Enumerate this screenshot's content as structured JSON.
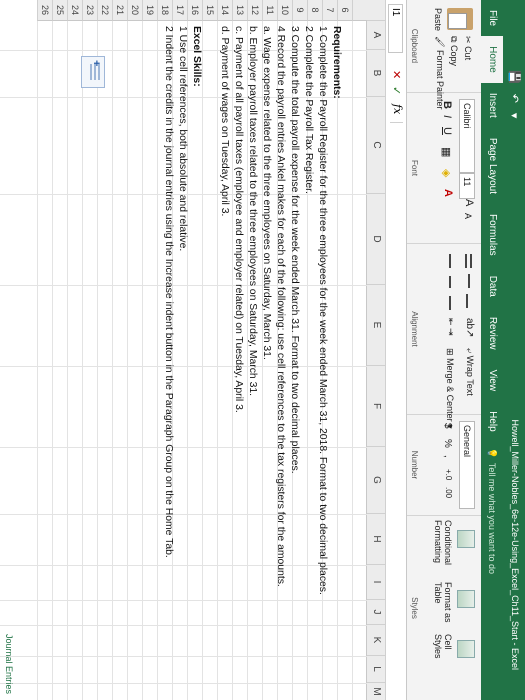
{
  "title_bar": {
    "document_title": "Howell_Miller-Nobles_6e-12e-Using_Excel_Ch11_Start - Excel"
  },
  "tabs": [
    "File",
    "Home",
    "Insert",
    "Page Layout",
    "Formulas",
    "Data",
    "Review",
    "View",
    "Help"
  ],
  "tell_me": "Tell me what you want to do",
  "ribbon": {
    "clipboard": {
      "cut": "Cut",
      "copy": "Copy",
      "format_painter": "Format Painter",
      "paste": "Paste",
      "label": "Clipboard"
    },
    "font": {
      "name": "Calibri",
      "size": "11",
      "bold": "B",
      "italic": "I",
      "underline": "U",
      "grow": "A",
      "shrink": "A",
      "label": "Font"
    },
    "alignment": {
      "wrap": "Wrap Text",
      "merge": "Merge & Center",
      "label": "Alignment"
    },
    "number": {
      "format": "General",
      "currency": "$",
      "percent": "%",
      "comma": ",",
      "label": "Number"
    },
    "styles": {
      "conditional": "Conditional Formatting",
      "format_table": "Format as Table",
      "cell_styles": "Cell Styles",
      "label": "Styles"
    }
  },
  "formula_bar": {
    "name_box": "I1",
    "cancel": "✕",
    "enter": "✓",
    "fx": "fx"
  },
  "columns": [
    "A",
    "B",
    "C",
    "D",
    "E",
    "F",
    "G",
    "H",
    "I",
    "J",
    "K",
    "L",
    "M"
  ],
  "rows": [
    "",
    "6",
    "7",
    "8",
    "9",
    "10",
    "11",
    "12",
    "13",
    "14",
    "15",
    "16",
    "17",
    "18",
    "19",
    "20",
    "21",
    "22",
    "23",
    "24",
    "25",
    "26"
  ],
  "content": {
    "requirements_heading": "Requirements:",
    "requirements": [
      "1  Complete the Payroll Register for the three employees for the week ended March 31, 2018. Format to two decimal places.",
      "2  Complete the Payroll Tax Register.",
      "3  Compute the total payroll expense for the week ended March 31. Format to two decimal places.",
      "4  Record the payroll entries Ankel makes for each of the following: use cell references to the tax registers for the amounts.",
      "    a. Wage expense related to the three employees on Saturday, March 31.",
      "    b. Employer payroll taxes related to the three employees on Saturday, March 31.",
      "    c. Payment of all payroll taxes (employee and employer related) on Tuesday, April 3.",
      "    d. Payment of wages on Tuesday, April 3."
    ],
    "skills_heading": "Excel Skills:",
    "skills": [
      "1  Use cell references, both absolute and relative.",
      "2  Indent the credits in the journal entries using the Increase indent button in the Paragraph Group on the Home Tab."
    ]
  },
  "bottom_partial": "Journal Entries"
}
